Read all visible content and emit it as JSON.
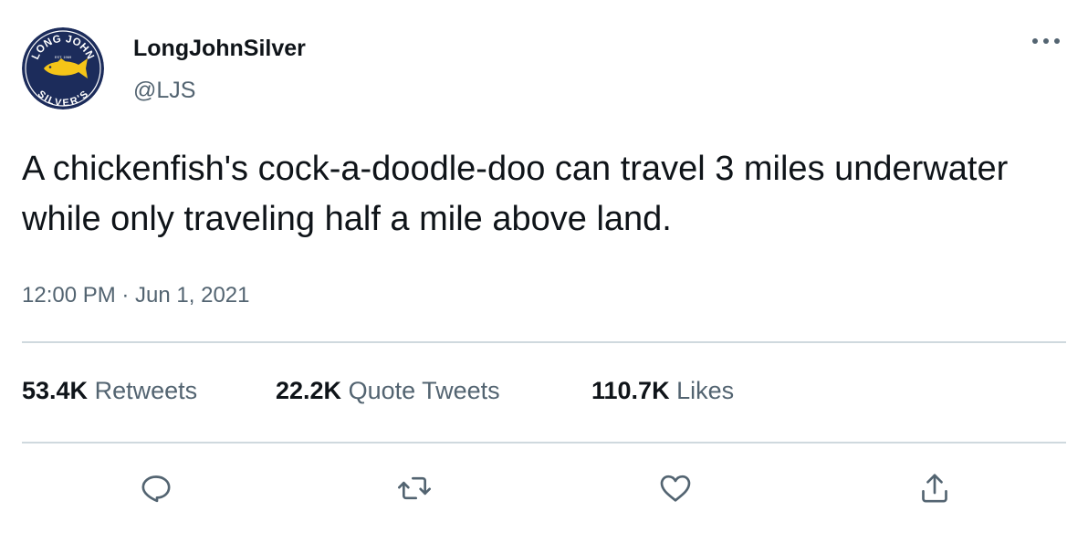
{
  "author": {
    "display_name": "LongJohnSilver",
    "handle": "@LJS",
    "avatar": {
      "top_text": "LONG JOHN",
      "bottom_text": "SILVER'S",
      "est_text": "EST. 1969",
      "colors": {
        "navy": "#1c2c5b",
        "gold": "#f5c518",
        "white": "#ffffff"
      }
    }
  },
  "tweet": {
    "text": "A chickenfish's cock-a-doodle-doo can travel 3 miles underwater while only traveling half a mile above land.",
    "timestamp": "12:00 PM · Jun 1, 2021"
  },
  "stats": {
    "retweets": {
      "count": "53.4K",
      "label": "Retweets"
    },
    "quote_tweets": {
      "count": "22.2K",
      "label": "Quote Tweets"
    },
    "likes": {
      "count": "110.7K",
      "label": "Likes"
    }
  },
  "actions": {
    "reply_icon": "reply-icon",
    "retweet_icon": "retweet-icon",
    "like_icon": "heart-icon",
    "share_icon": "share-icon"
  },
  "colors": {
    "text": "#0f1419",
    "secondary": "#536471",
    "divider": "#cfd9de"
  }
}
